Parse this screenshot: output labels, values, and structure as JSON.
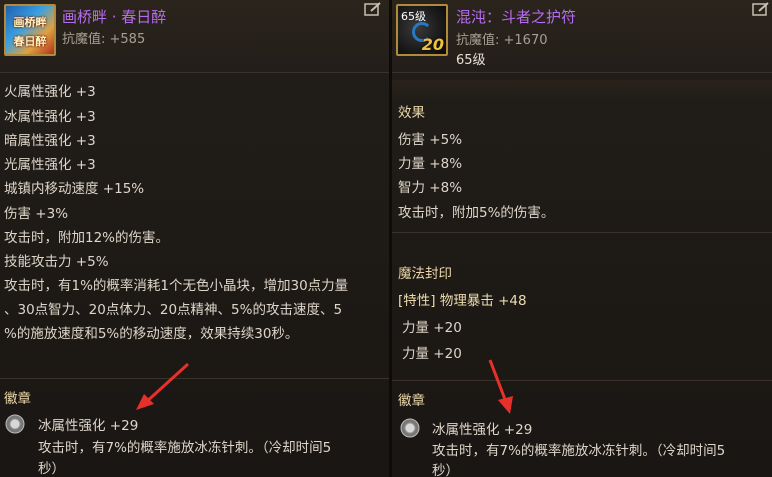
{
  "left": {
    "title": "画桥畔 · 春日醉",
    "icon_text_top": "画桥畔",
    "icon_text_bottom": "春日醉",
    "resist": "抗魔值: +585",
    "stats": [
      "火属性强化 +3",
      "冰属性强化 +3",
      "暗属性强化 +3",
      "光属性强化 +3",
      "城镇内移动速度 +15%",
      "伤害 +3%",
      "攻击时，附加12%的伤害。",
      "技能攻击力 +5%"
    ],
    "long_effect": [
      "攻击时，有1%的概率消耗1个无色小晶块，增加30点力量",
      "、30点智力、20点体力、20点精神、5%的攻击速度、5",
      "%的施放速度和5%的移动速度，效果持续30秒。"
    ],
    "badge_title": "徽章",
    "badge_stat": "冰属性强化 +29",
    "badge_desc_1": "攻击时，有7%的概率施放冰冻针刺。（冷却时间5",
    "badge_desc_2": "秒）"
  },
  "right": {
    "title": "混沌：斗者之护符",
    "icon_level": "65级",
    "icon_number": "20",
    "resist": "抗魔值: +1670",
    "level": "65级",
    "effect_title": "效果",
    "effects": [
      "伤害 +5%",
      "力量 +8%",
      "智力 +8%",
      "攻击时，附加5%的伤害。"
    ],
    "seal_title": "魔法封印",
    "seal_trait": "[特性] 物理暴击 +48",
    "seal_stats": [
      "力量 +20",
      "力量 +20"
    ],
    "badge_title": "徽章",
    "badge_stat": "冰属性强化 +29",
    "badge_desc_1": "攻击时，有7%的概率施放冰冻针刺。（冷却时间5",
    "badge_desc_2": "秒）"
  },
  "colors": {
    "title": "#b66cf0",
    "arrow": "#e8302a",
    "section": "#e8d6a8"
  },
  "icons": {
    "edit": "edit-icon",
    "badge_gem": "gear-gem-icon"
  }
}
